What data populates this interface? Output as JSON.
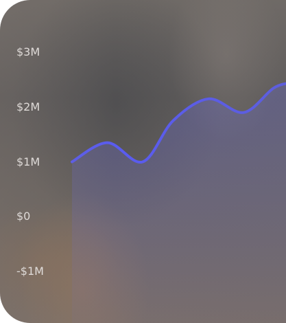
{
  "chart_data": {
    "type": "area",
    "title": "",
    "xlabel": "",
    "ylabel": "",
    "yticks": [
      "$3M",
      "$2M",
      "$1M",
      "$0",
      "-$1M"
    ],
    "ylim": [
      -1000000,
      3000000
    ],
    "grid": false,
    "series": [
      {
        "color": "#5a5cf0",
        "points": [
          [
            0.0,
            1000000
          ],
          [
            0.35,
            1350000
          ],
          [
            0.7,
            1000000
          ],
          [
            1.0,
            1750000
          ],
          [
            1.35,
            2150000
          ],
          [
            1.7,
            1900000
          ],
          [
            2.0,
            2350000
          ],
          [
            2.2,
            2450000
          ]
        ]
      }
    ]
  }
}
